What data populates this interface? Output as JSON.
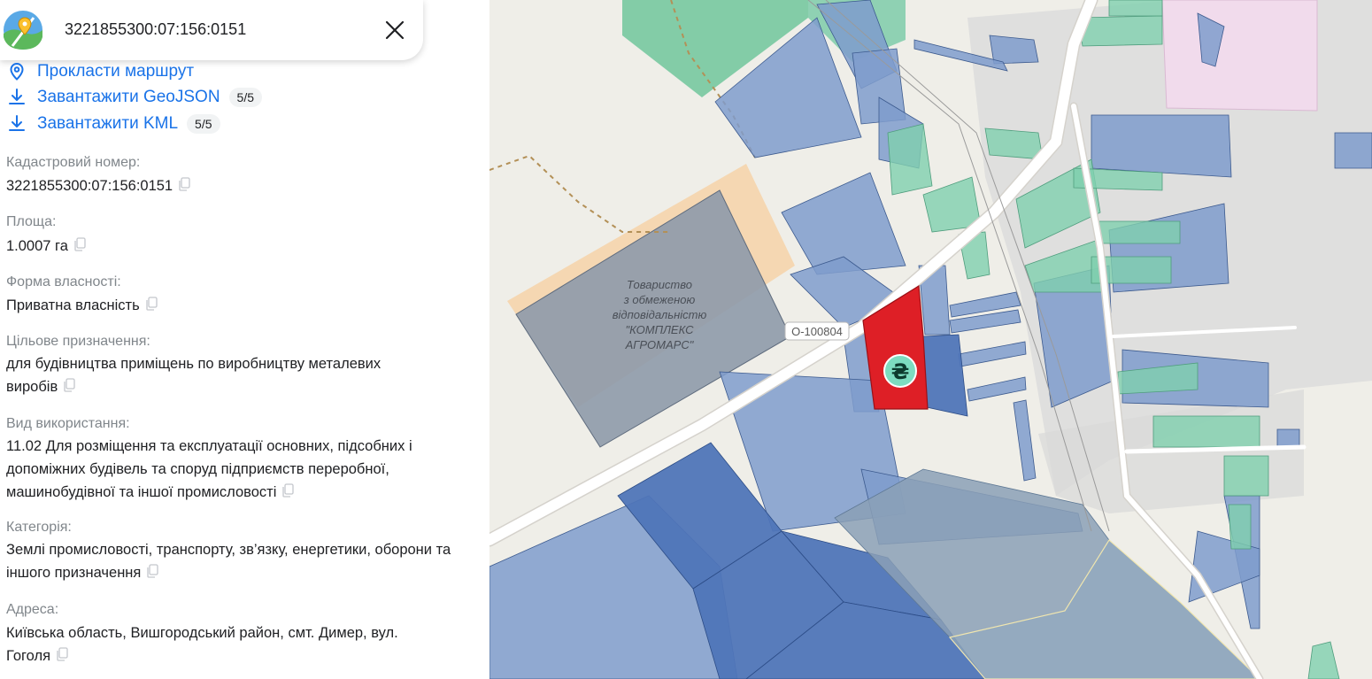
{
  "search": {
    "value": "3221855300:07:156:0151"
  },
  "actions": [
    {
      "label": "Прокласти маршрут",
      "icon": "location-pin-icon"
    },
    {
      "label": "Завантажити GeoJSON",
      "icon": "download-icon",
      "badge": "5/5"
    },
    {
      "label": "Завантажити KML",
      "icon": "download-icon",
      "badge": "5/5"
    }
  ],
  "fields": {
    "cadastral": {
      "label": "Кадастровий номер:",
      "value": "3221855300:07:156:0151"
    },
    "area": {
      "label": "Площа:",
      "value": "1.0007 га"
    },
    "ownership": {
      "label": "Форма власності:",
      "value": "Приватна власність"
    },
    "purpose": {
      "label": "Цільове призначення:",
      "value": "для будівництва приміщень по виробництву металевих виробів"
    },
    "usage": {
      "label": "Вид використання:",
      "value": "11.02 Для розміщення та експлуатації основних, підсобних і допоміжних будівель та споруд підприємств переробної, машинобудівної та іншої промисловості"
    },
    "category": {
      "label": "Категорія:",
      "value": "Землі промисловості, транспорту, зв’язку, енергетики, оборони та іншого призначення"
    },
    "address": {
      "label": "Адреса:",
      "value": "Київська область, Вишгородський район, смт. Димер, вул. Гоголя"
    }
  },
  "map": {
    "road_label": "O-100804",
    "company_label": [
      "Товариство",
      "з обмеженою",
      "відповідальністю",
      "\"КОМПЛЕКС",
      "АГРОМАРС\""
    ],
    "marker_symbol": "₴",
    "colors": {
      "selected_parcel": "#de1f26",
      "marker": "#7ddcc0",
      "parcel_blue": "#7f9ccd",
      "parcel_dark_blue": "#4f75b8",
      "parcel_green": "#80cfae",
      "background": "#efeee8"
    }
  }
}
